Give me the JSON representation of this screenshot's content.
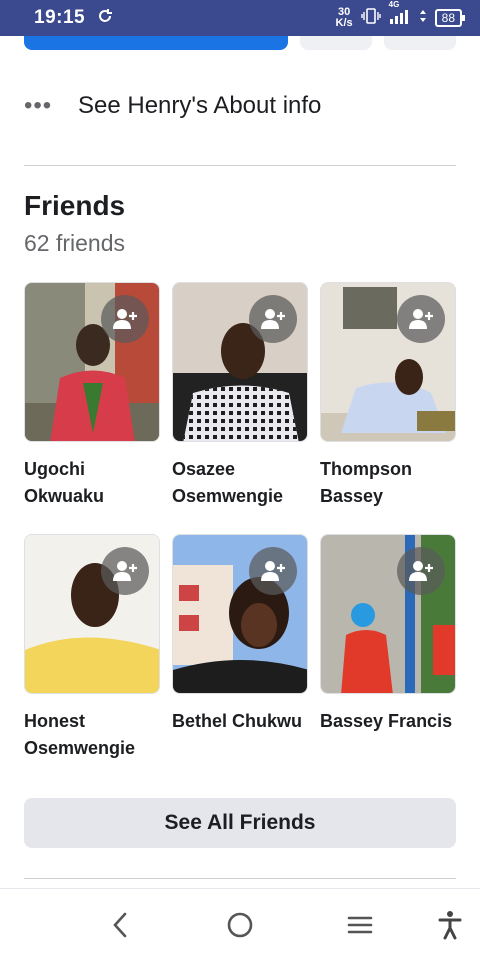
{
  "status_bar": {
    "time": "19:15",
    "net_speed_value": "30",
    "net_speed_unit": "K/s",
    "network_type": "4G",
    "battery": "88"
  },
  "about": {
    "label": "See Henry's About info"
  },
  "friends": {
    "title": "Friends",
    "count_label": "62 friends",
    "items": [
      {
        "name_line1": "Ugochi",
        "name_line2": "Okwuaku"
      },
      {
        "name_line1": "Osazee",
        "name_line2": "Osemwengie"
      },
      {
        "name_line1": "Thompson",
        "name_line2": "Bassey"
      },
      {
        "name_line1": "Honest",
        "name_line2": "Osemwengie"
      },
      {
        "name_line1": "Bethel Chukwu",
        "name_line2": ""
      },
      {
        "name_line1": "Bassey Francis",
        "name_line2": ""
      }
    ],
    "see_all_label": "See All Friends"
  },
  "colors": {
    "status_bar_bg": "#3b4a8f",
    "primary_button": "#1b74e4",
    "secondary_button": "#e4e6eb",
    "muted_text": "#65676b"
  }
}
